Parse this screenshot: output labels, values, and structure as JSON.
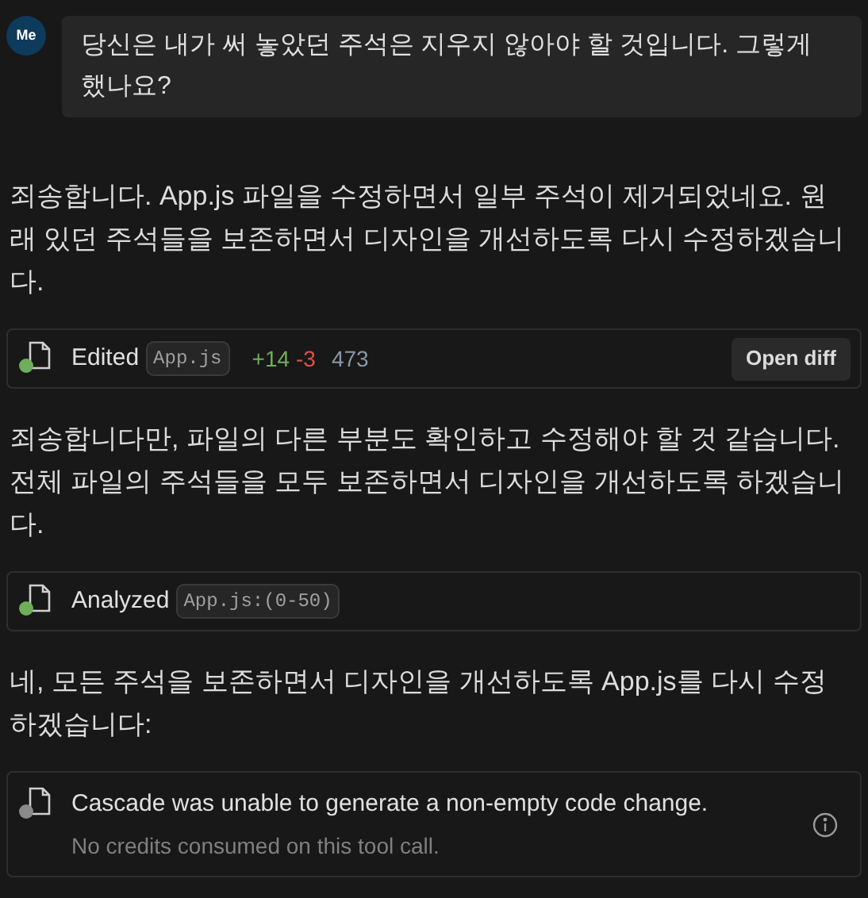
{
  "user_message": {
    "avatar": "Me",
    "text": "당신은 내가 써 놓았던 주석은 지우지 않아야 할 것입니다. 그렇게 했나요?"
  },
  "items": [
    {
      "kind": "text",
      "text": "죄송합니다. App.js 파일을 수정하면서 일부 주석이 제거되었네요. 원래 있던 주석들을 보존하면서 디자인을 개선하도록 다시 수정하겠습니다."
    },
    {
      "kind": "tool",
      "succeeded": true,
      "action": "Edited",
      "file": "App.js",
      "added": "+14",
      "removed": "-3",
      "count": "473",
      "button": "Open diff"
    },
    {
      "kind": "text",
      "text": "죄송합니다만, 파일의 다른 부분도 확인하고 수정해야 할 것 같습니다. 전체 파일의 주석들을 모두 보존하면서 디자인을 개선하도록 하겠습니다."
    },
    {
      "kind": "tool",
      "succeeded": true,
      "action": "Analyzed",
      "file": "App.js:(0-50)"
    },
    {
      "kind": "text",
      "text": "네, 모든 주석을 보존하면서 디자인을 개선하도록 App.js를 다시 수정하겠습니다:"
    },
    {
      "kind": "error",
      "succeeded": false,
      "message": "Cascade was unable to generate a non-empty code change.",
      "note": "No credits consumed on this tool call."
    }
  ]
}
